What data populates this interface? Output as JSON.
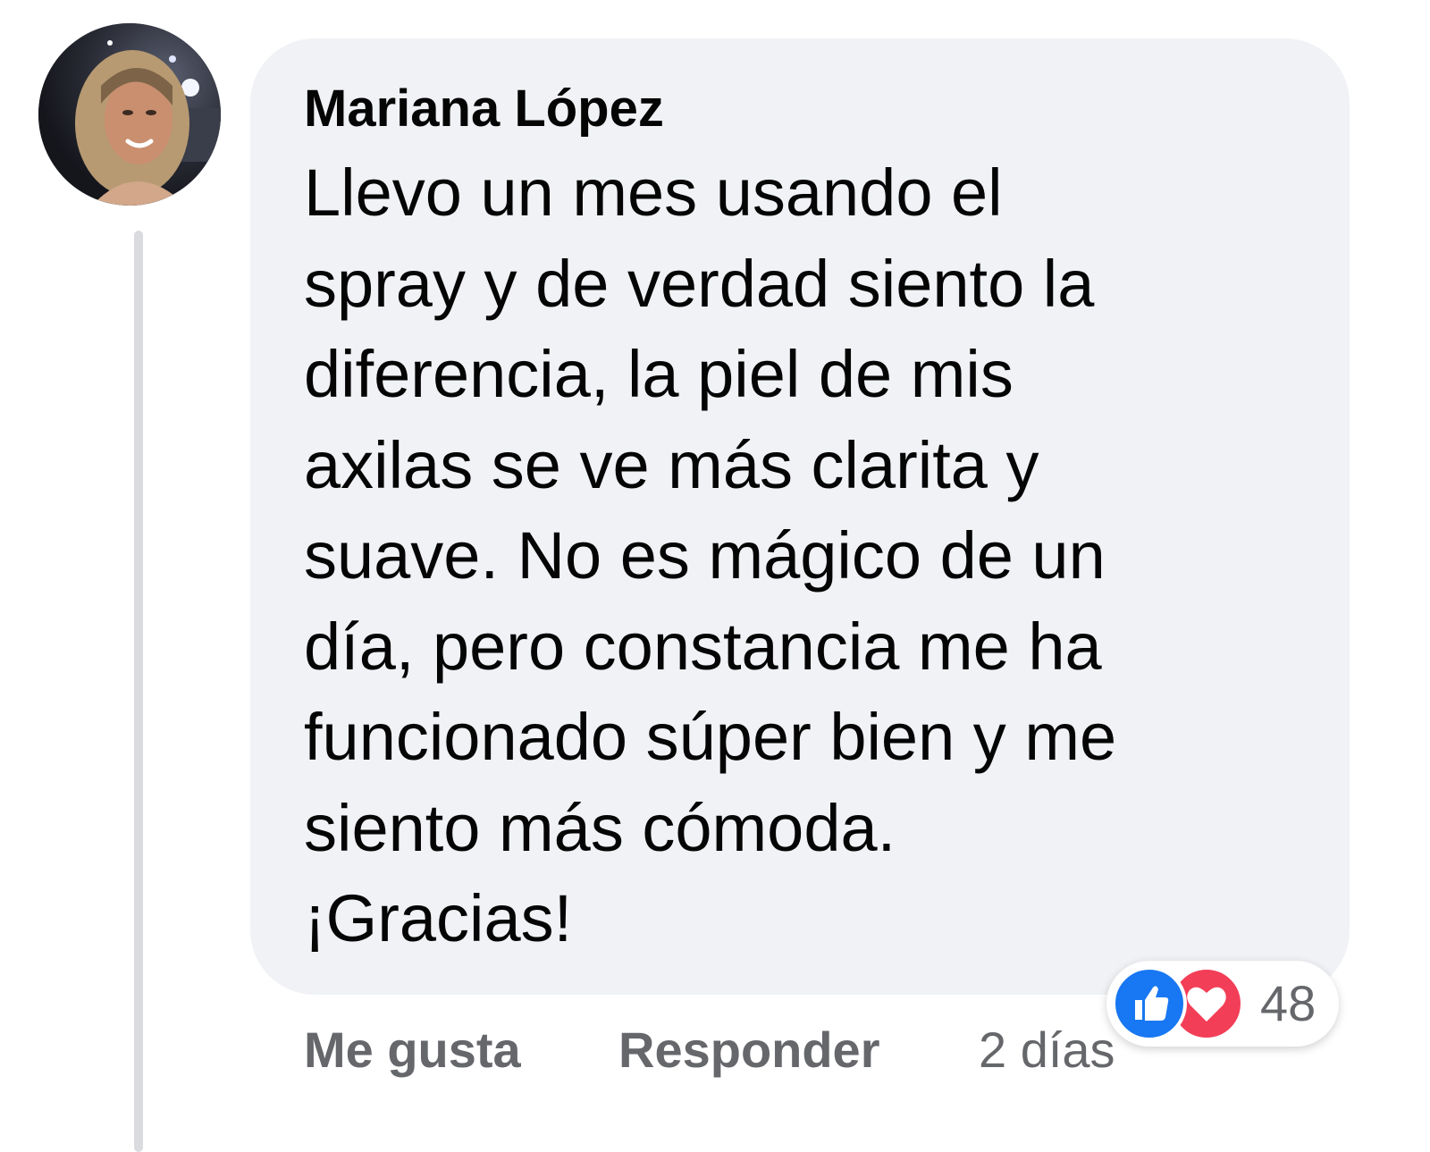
{
  "comment": {
    "author": "Mariana López",
    "text_lines": [
      "Llevo un mes usando el",
      "spray y de verdad siento la",
      "diferencia, la piel de mis",
      "axilas se ve más clarita y",
      "suave. No es mágico de un",
      "día, pero constancia me ha",
      "funcionado súper bien y me",
      "siento más cómoda.",
      "¡Gracias!"
    ],
    "avatar_icon": "profile-photo"
  },
  "actions": {
    "like_label": "Me gusta",
    "reply_label": "Responder",
    "timestamp": "2 días"
  },
  "reactions": {
    "icons": [
      "like-reaction-icon",
      "love-reaction-icon"
    ],
    "count": "48"
  },
  "colors": {
    "bubble_bg": "#f0f2f5",
    "text": "#050505",
    "secondary_text": "#65676b",
    "like_blue": "#1877f2",
    "love_red": "#f33e58"
  }
}
